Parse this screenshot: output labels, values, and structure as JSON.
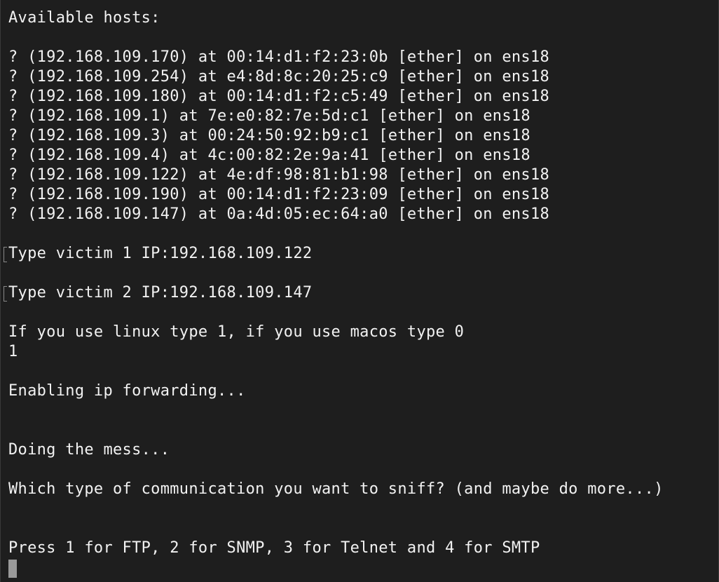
{
  "terminal": {
    "header": "Available hosts:",
    "hosts": [
      "? (192.168.109.170) at 00:14:d1:f2:23:0b [ether] on ens18",
      "? (192.168.109.254) at e4:8d:8c:20:25:c9 [ether] on ens18",
      "? (192.168.109.180) at 00:14:d1:f2:c5:49 [ether] on ens18",
      "? (192.168.109.1) at 7e:e0:82:7e:5d:c1 [ether] on ens18",
      "? (192.168.109.3) at 00:24:50:92:b9:c1 [ether] on ens18",
      "? (192.168.109.4) at 4c:00:82:2e:9a:41 [ether] on ens18",
      "? (192.168.109.122) at 4e:df:98:81:b1:98 [ether] on ens18",
      "? (192.168.109.190) at 00:14:d1:f2:23:09 [ether] on ens18",
      "? (192.168.109.147) at 0a:4d:05:ec:64:a0 [ether] on ens18"
    ],
    "victim1_prompt": "Type victim 1 IP:192.168.109.122",
    "victim2_prompt": "Type victim 2 IP:192.168.109.147",
    "os_prompt": "If you use linux type 1, if you use macos type 0",
    "os_answer": "1",
    "forwarding_msg": "Enabling ip forwarding...",
    "mess_msg": "Doing the mess...",
    "sniff_question": "Which type of communication you want to sniff? (and maybe do more...)",
    "protocol_prompt": "Press 1 for FTP, 2 for SNMP, 3 for Telnet and 4 for SMTP"
  }
}
